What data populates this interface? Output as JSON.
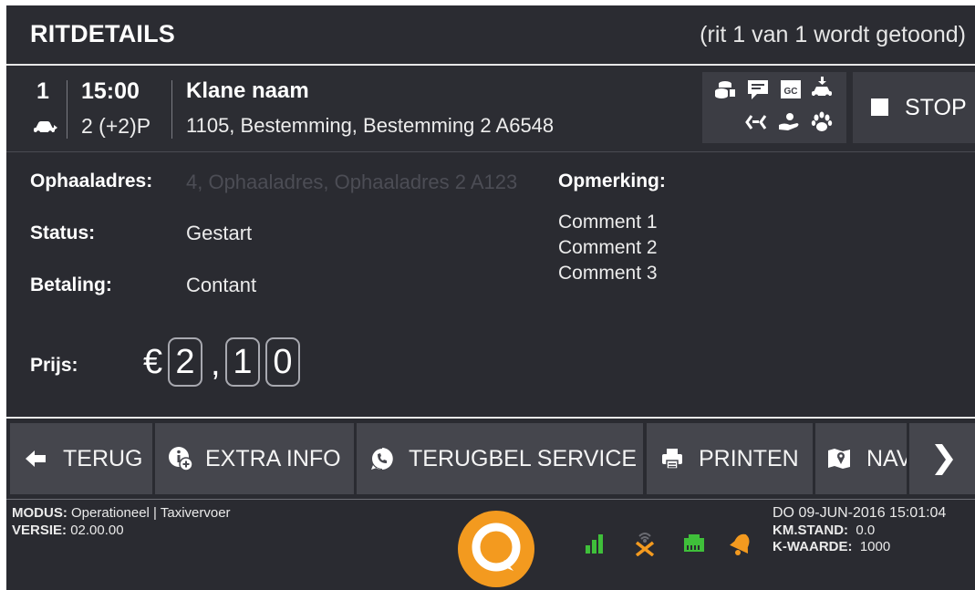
{
  "header": {
    "title": "RITDETAILS",
    "subtitle": "(rit 1 van 1 wordt getoond)"
  },
  "ride": {
    "number": "1",
    "time": "15:00",
    "passengers": "2 (+2)P",
    "customer": "Klane naam",
    "destination": "1105, Bestemming, Bestemming 2 A6548",
    "stop_label": "STOP",
    "feature_icons": [
      "coins-icon",
      "message-icon",
      "gc-badge-icon",
      "car-download-icon",
      "transfer-arrows-icon",
      "hand-coin-icon",
      "paw-icon"
    ]
  },
  "details": {
    "pickup_label": "Ophaaladres:",
    "pickup_value": "4, Ophaaladres, Ophaaladres 2 A123",
    "status_label": "Status:",
    "status_value": "Gestart",
    "payment_label": "Betaling:",
    "payment_value": "Contant",
    "remark_label": "Opmerking:",
    "comments": [
      "Comment 1",
      "Comment 2",
      "Comment 3"
    ],
    "price_label": "Prijs:",
    "currency": "€",
    "price_digits": [
      "2",
      "1",
      "0"
    ],
    "decimal_separator": ","
  },
  "toolbar": {
    "back": "TERUG",
    "extra_info": "EXTRA INFO",
    "callback": "TERUGBEL SERVICE",
    "print": "PRINTEN",
    "nav": "NAV"
  },
  "status": {
    "mode_label": "MODUS:",
    "mode_value": "Operationeel | Taxivervoer",
    "version_label": "VERSIE:",
    "version_value": "02.00.00",
    "datetime": "DO 09-JUN-2016 15:01:04",
    "km_label": "KM.STAND:",
    "km_value": "0.0",
    "k_label": "K-WAARDE:",
    "k_value": "1000"
  },
  "colors": {
    "accent_orange": "#f39a1f",
    "status_green": "#3fbf3a",
    "background": "#2a2b31",
    "button": "#45464d"
  }
}
